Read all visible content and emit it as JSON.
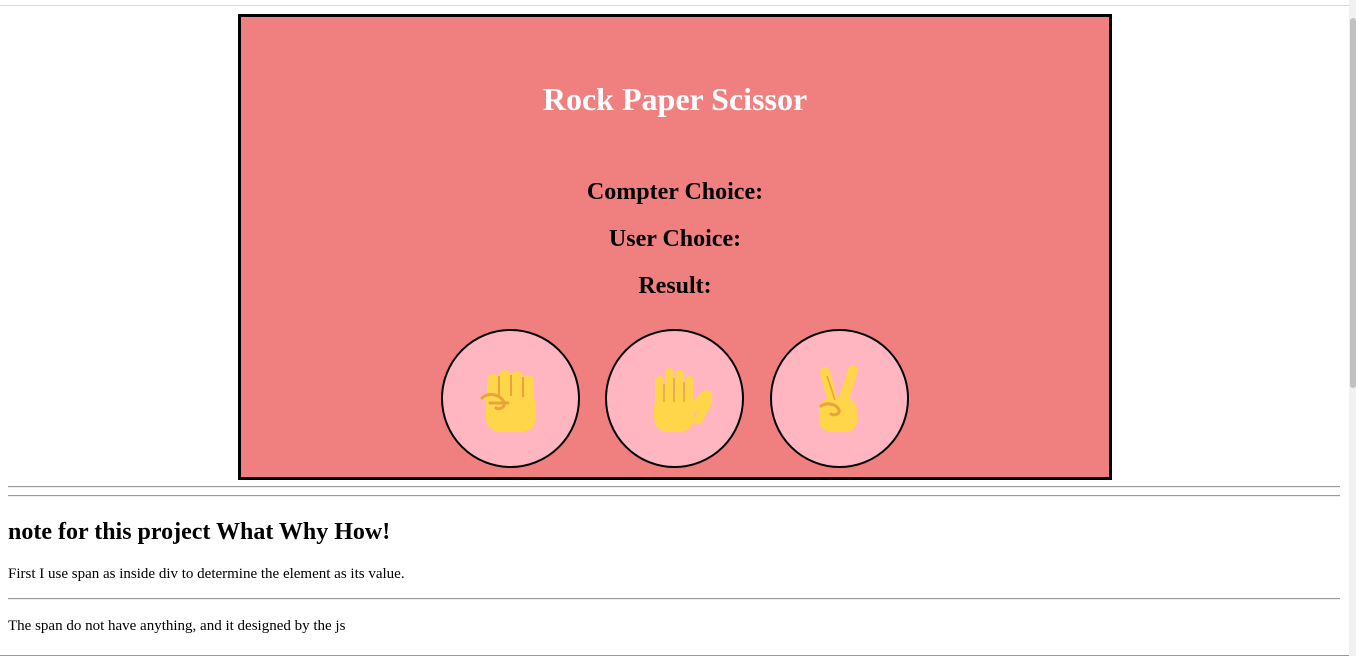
{
  "game": {
    "title": "Rock Paper Scissor",
    "computer_choice_label": "Compter Choice:",
    "user_choice_label": "User Choice:",
    "result_label": "Result:",
    "choices": [
      {
        "name": "rock",
        "icon": "raised-fist-icon"
      },
      {
        "name": "paper",
        "icon": "raised-hand-icon"
      },
      {
        "name": "scissor",
        "icon": "victory-hand-icon"
      }
    ],
    "colors": {
      "panel": "#f08080",
      "button": "#ffb6c1",
      "title": "#ffffff"
    }
  },
  "notes": {
    "title": "note for this project What Why How!",
    "paragraph1": "First I use span as inside div to determine the element as its value.",
    "paragraph2": "The span do not have anything, and it designed by the js"
  }
}
